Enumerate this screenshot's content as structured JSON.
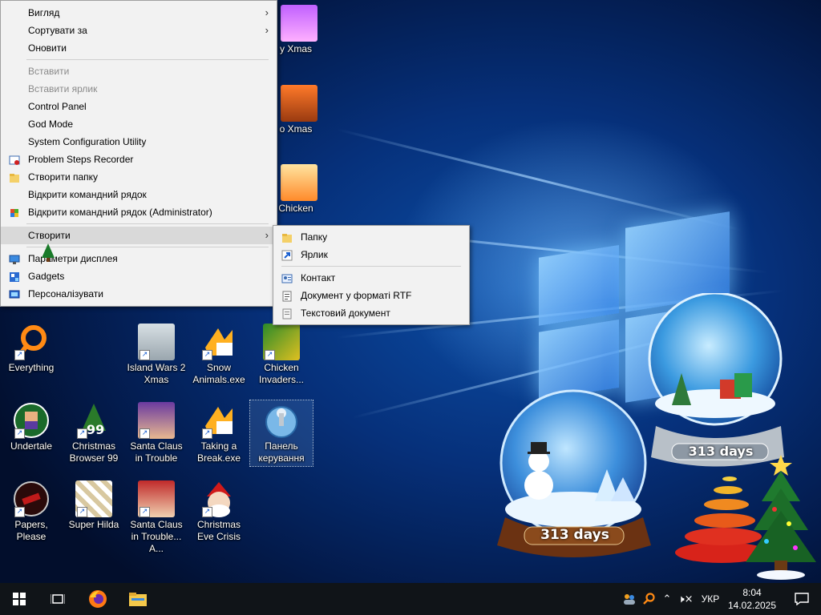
{
  "context_menu": {
    "items": [
      {
        "label": "Вигляд",
        "submenu": true
      },
      {
        "label": "Сортувати за",
        "submenu": true
      },
      {
        "label": "Оновити"
      },
      {
        "label": "Вставити",
        "disabled": true
      },
      {
        "label": "Вставити ярлик",
        "disabled": true
      },
      {
        "label": "Control Panel"
      },
      {
        "label": "God Mode"
      },
      {
        "label": "System Configuration Utility"
      },
      {
        "label": "Problem Steps Recorder",
        "icon": "steps-recorder-icon"
      },
      {
        "label": "Створити папку",
        "icon": "folder-icon"
      },
      {
        "label": "Відкрити командний рядок"
      },
      {
        "label": "Відкрити командний рядок (Administrator)",
        "icon": "shield-icon"
      },
      {
        "label": "Створити",
        "submenu": true,
        "highlighted": true
      },
      {
        "label": "Параметри дисплея",
        "icon": "display-icon"
      },
      {
        "label": "Gadgets",
        "icon": "gadgets-icon"
      },
      {
        "label": "Персоналізувати",
        "icon": "personalize-icon"
      }
    ]
  },
  "submenu": {
    "items": [
      {
        "label": "Папку",
        "icon": "folder-icon"
      },
      {
        "label": "Ярлик",
        "icon": "shortcut-icon"
      },
      {
        "label": "Контакт",
        "icon": "contact-icon"
      },
      {
        "label": "Документ у форматі RTF",
        "icon": "rtf-document-icon"
      },
      {
        "label": "Текстовий документ",
        "icon": "text-document-icon"
      }
    ]
  },
  "desktop": {
    "partial_icons": [
      {
        "label": "y Xmas"
      },
      {
        "label": "o Xmas"
      },
      {
        "label": "Chicken"
      }
    ],
    "icons": [
      {
        "label": "Everything"
      },
      {
        "label": "Island Wars 2 Xmas"
      },
      {
        "label": "Snow Animals.exe"
      },
      {
        "label": "Chicken Invaders..."
      },
      {
        "label": "Undertale"
      },
      {
        "label": "Christmas Browser 99"
      },
      {
        "label": "Santa Claus in Trouble"
      },
      {
        "label": "Taking a Break.exe"
      },
      {
        "label": "Панель керування"
      },
      {
        "label": "Papers, Please"
      },
      {
        "label": "Super Hilda"
      },
      {
        "label": "Santa Claus in Trouble... A..."
      },
      {
        "label": "Christmas Eve Crisis"
      }
    ],
    "snowglobe_left_text": "313 days",
    "snowglobe_right_text": "313 days"
  },
  "taskbar": {
    "language": "УКР",
    "time": "8:04",
    "date": "14.02.2025"
  },
  "colors": {
    "menu_bg": "#f2f2f2",
    "menu_highlight": "#d9d9d9",
    "taskbar_bg": "#101418",
    "accent_blue": "#0c4fa8"
  }
}
